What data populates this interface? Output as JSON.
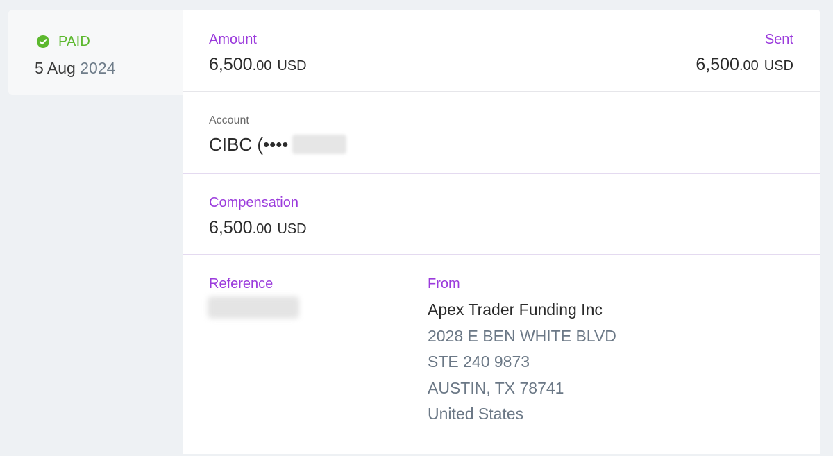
{
  "status": {
    "label": "PAID",
    "date_day_month": "5 Aug",
    "date_year": "2024",
    "icon": "check-circle-icon",
    "color": "#5cb82e"
  },
  "amount": {
    "label": "Amount",
    "whole": "6,500",
    "cents": ".00",
    "currency": "USD"
  },
  "sent": {
    "label": "Sent",
    "whole": "6,500",
    "cents": ".00",
    "currency": "USD"
  },
  "account": {
    "label": "Account",
    "value": "CIBC (••••"
  },
  "compensation": {
    "label": "Compensation",
    "whole": "6,500",
    "cents": ".00",
    "currency": "USD"
  },
  "reference": {
    "label": "Reference"
  },
  "from": {
    "label": "From",
    "name": "Apex Trader Funding Inc",
    "address": [
      "2028 E BEN WHITE BLVD",
      "STE 240 9873",
      "AUSTIN, TX 78741",
      "United States"
    ]
  },
  "colors": {
    "accent_label": "#9b3bdc",
    "divider": "#e4daf0",
    "page_bg": "#eef1f4"
  }
}
